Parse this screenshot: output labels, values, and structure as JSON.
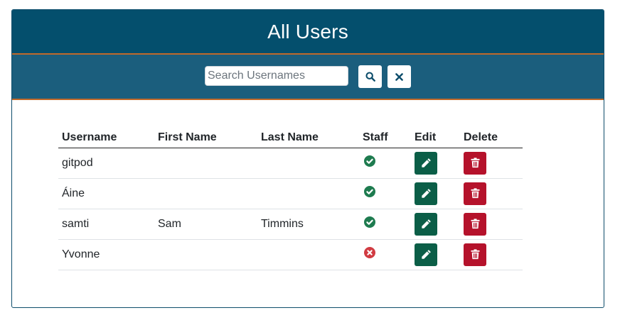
{
  "page": {
    "title": "All Users"
  },
  "search": {
    "placeholder": "Search Usernames",
    "value": ""
  },
  "icons": {
    "search_button": "search-icon",
    "clear_button": "close-icon",
    "edit": "pencil-icon",
    "delete": "trash-icon",
    "staff_true": "check-circle-icon",
    "staff_false": "x-circle-icon"
  },
  "colors": {
    "header_bg": "#044f6d",
    "searchbar_bg": "#1b5e7d",
    "accent_line": "#c0692b",
    "edit_button": "#0b5e47",
    "delete_button": "#b5122b",
    "staff_yes": "#1e7b4f",
    "staff_no": "#d13b42"
  },
  "table": {
    "headers": {
      "username": "Username",
      "first_name": "First Name",
      "last_name": "Last Name",
      "staff": "Staff",
      "edit": "Edit",
      "delete": "Delete"
    },
    "rows": [
      {
        "username": "gitpod",
        "first_name": "",
        "last_name": "",
        "staff": true
      },
      {
        "username": "Áine",
        "first_name": "",
        "last_name": "",
        "staff": true
      },
      {
        "username": "samti",
        "first_name": "Sam",
        "last_name": "Timmins",
        "staff": true
      },
      {
        "username": "Yvonne",
        "first_name": "",
        "last_name": "",
        "staff": false
      }
    ]
  }
}
